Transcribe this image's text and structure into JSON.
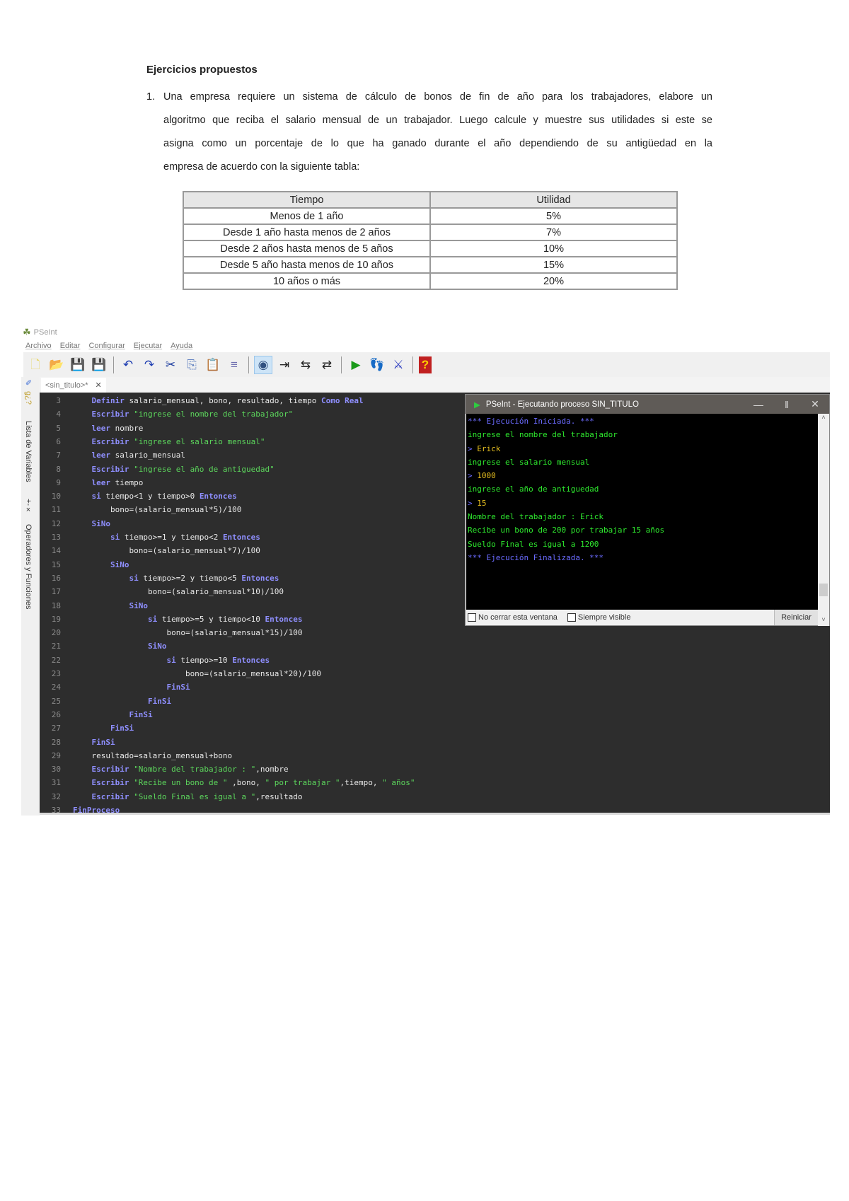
{
  "document": {
    "heading": "Ejercicios propuestos",
    "item_number": "1.",
    "paragraph_lines": [
      "Una empresa requiere un sistema de cálculo de bonos de fin de año para los trabajadores, elabore un",
      "algoritmo que reciba el salario mensual de un trabajador. Luego calcule y muestre sus utilidades si este se",
      "asigna como un porcentaje de lo que ha ganado durante el año dependiendo de su antigüedad en la",
      "empresa de acuerdo con la siguiente tabla:"
    ],
    "table": {
      "headers": [
        "Tiempo",
        "Utilidad"
      ],
      "rows": [
        [
          "Menos de 1 año",
          "5%"
        ],
        [
          "Desde 1 año hasta menos de 2 años",
          "7%"
        ],
        [
          "Desde 2 años hasta menos de 5 años",
          "10%"
        ],
        [
          "Desde 5 año hasta menos de 10 años",
          "15%"
        ],
        [
          "10 años o más",
          "20%"
        ]
      ]
    }
  },
  "app": {
    "title": "PSeInt",
    "menu": [
      "Archivo",
      "Editar",
      "Configurar",
      "Ejecutar",
      "Ayuda"
    ],
    "toolbar_icons": [
      "new-file",
      "open-folder",
      "save",
      "save-as",
      "undo",
      "redo",
      "cut",
      "copy",
      "paste",
      "edit-lines",
      "variables-watch",
      "indent",
      "comment",
      "uncomment",
      "run",
      "step-by-step",
      "flowchart",
      "help"
    ],
    "side_panels": [
      "Lista de Variables",
      "Operadores y Funciones"
    ],
    "tab_label": "<sin_titulo>*",
    "code_lines": [
      {
        "n": "3",
        "t": [
          [
            "kw",
            "    Definir "
          ],
          [
            "pl",
            "salario_mensual, bono, resultado, tiempo "
          ],
          [
            "kw",
            "Como Real"
          ]
        ]
      },
      {
        "n": "4",
        "t": [
          [
            "kw",
            "    Escribir "
          ],
          [
            "st",
            "\"ingrese el nombre del trabajador\""
          ]
        ]
      },
      {
        "n": "5",
        "t": [
          [
            "kw",
            "    leer "
          ],
          [
            "pl",
            "nombre"
          ]
        ]
      },
      {
        "n": "6",
        "t": [
          [
            "kw",
            "    Escribir "
          ],
          [
            "st",
            "\"ingrese el salario mensual\""
          ]
        ]
      },
      {
        "n": "7",
        "t": [
          [
            "kw",
            "    leer "
          ],
          [
            "pl",
            "salario_mensual"
          ]
        ]
      },
      {
        "n": "8",
        "t": [
          [
            "kw",
            "    Escribir "
          ],
          [
            "st",
            "\"ingrese el año de antiguedad\""
          ]
        ]
      },
      {
        "n": "9",
        "t": [
          [
            "kw",
            "    leer "
          ],
          [
            "pl",
            "tiempo"
          ]
        ]
      },
      {
        "n": "10",
        "t": [
          [
            "kw",
            "    si "
          ],
          [
            "pl",
            "tiempo<1 y tiempo>0 "
          ],
          [
            "kw",
            "Entonces"
          ]
        ]
      },
      {
        "n": "11",
        "t": [
          [
            "pl",
            "        bono=(salario_mensual*5)/100"
          ]
        ]
      },
      {
        "n": "12",
        "t": [
          [
            "kw",
            "    SiNo"
          ]
        ]
      },
      {
        "n": "13",
        "t": [
          [
            "kw",
            "        si "
          ],
          [
            "pl",
            "tiempo>=1 y tiempo<2 "
          ],
          [
            "kw",
            "Entonces"
          ]
        ]
      },
      {
        "n": "14",
        "t": [
          [
            "pl",
            "            bono=(salario_mensual*7)/100"
          ]
        ]
      },
      {
        "n": "15",
        "t": [
          [
            "kw",
            "        SiNo"
          ]
        ]
      },
      {
        "n": "16",
        "t": [
          [
            "kw",
            "            si "
          ],
          [
            "pl",
            "tiempo>=2 y tiempo<5 "
          ],
          [
            "kw",
            "Entonces"
          ]
        ]
      },
      {
        "n": "17",
        "t": [
          [
            "pl",
            "                bono=(salario_mensual*10)/100"
          ]
        ]
      },
      {
        "n": "18",
        "t": [
          [
            "kw",
            "            SiNo"
          ]
        ]
      },
      {
        "n": "19",
        "t": [
          [
            "kw",
            "                si "
          ],
          [
            "pl",
            "tiempo>=5 y tiempo<10 "
          ],
          [
            "kw",
            "Entonces"
          ]
        ]
      },
      {
        "n": "20",
        "t": [
          [
            "pl",
            "                    bono=(salario_mensual*15)/100"
          ]
        ]
      },
      {
        "n": "21",
        "t": [
          [
            "kw",
            "                SiNo"
          ]
        ]
      },
      {
        "n": "22",
        "t": [
          [
            "kw",
            "                    si "
          ],
          [
            "pl",
            "tiempo>=10 "
          ],
          [
            "kw",
            "Entonces"
          ]
        ]
      },
      {
        "n": "23",
        "t": [
          [
            "pl",
            "                        bono=(salario_mensual*20)/100"
          ]
        ]
      },
      {
        "n": "24",
        "t": [
          [
            "kw",
            "                    FinSi"
          ]
        ]
      },
      {
        "n": "25",
        "t": [
          [
            "kw",
            "                FinSi"
          ]
        ]
      },
      {
        "n": "26",
        "t": [
          [
            "kw",
            "            FinSi"
          ]
        ]
      },
      {
        "n": "27",
        "t": [
          [
            "kw",
            "        FinSi"
          ]
        ]
      },
      {
        "n": "28",
        "t": [
          [
            "kw",
            "    FinSi"
          ]
        ]
      },
      {
        "n": "29",
        "t": [
          [
            "pl",
            "    resultado=salario_mensual+bono"
          ]
        ]
      },
      {
        "n": "30",
        "t": [
          [
            "kw",
            "    Escribir "
          ],
          [
            "st",
            "\"Nombre del trabajador : \""
          ],
          [
            "pl",
            ",nombre"
          ]
        ]
      },
      {
        "n": "31",
        "t": [
          [
            "kw",
            "    Escribir "
          ],
          [
            "st",
            "\"Recibe un bono de \""
          ],
          [
            "pl",
            " ,bono, "
          ],
          [
            "st",
            "\" por trabajar \""
          ],
          [
            "pl",
            ",tiempo, "
          ],
          [
            "st",
            "\" años\""
          ]
        ]
      },
      {
        "n": "32",
        "t": [
          [
            "kw",
            "    Escribir "
          ],
          [
            "st",
            "\"Sueldo Final es igual a \""
          ],
          [
            "pl",
            ",resultado"
          ]
        ]
      },
      {
        "n": "33",
        "t": [
          [
            "kw",
            "FinProceso"
          ]
        ]
      }
    ]
  },
  "console": {
    "title": "PSeInt - Ejecutando proceso SIN_TITULO",
    "lines": [
      [
        [
          "cb",
          "*** Ejecución Iniciada. ***"
        ]
      ],
      [
        [
          "cg",
          "ingrese el nombre del trabajador"
        ]
      ],
      [
        [
          "cb",
          "> "
        ],
        [
          "cy",
          "Erick"
        ]
      ],
      [
        [
          "cg",
          "ingrese el salario mensual"
        ]
      ],
      [
        [
          "cb",
          "> "
        ],
        [
          "cy",
          "1000"
        ]
      ],
      [
        [
          "cg",
          "ingrese el año de antiguedad"
        ]
      ],
      [
        [
          "cb",
          "> "
        ],
        [
          "cy",
          "15"
        ]
      ],
      [
        [
          "cg",
          "Nombre del trabajador : Erick"
        ]
      ],
      [
        [
          "cg",
          "Recibe un bono de 200 por trabajar 15 años"
        ]
      ],
      [
        [
          "cg",
          "Sueldo Final es igual a 1200"
        ]
      ],
      [
        [
          "cb",
          "*** Ejecución Finalizada. ***"
        ]
      ]
    ],
    "keep_open_label": "No cerrar esta ventana",
    "always_visible_label": "Siempre visible",
    "restart_label": "Reiniciar"
  },
  "colors": {
    "keyword": "#8f8fff",
    "string": "#5cd65c",
    "editor_bg": "#2d2d2d",
    "console_bg": "#000000"
  }
}
